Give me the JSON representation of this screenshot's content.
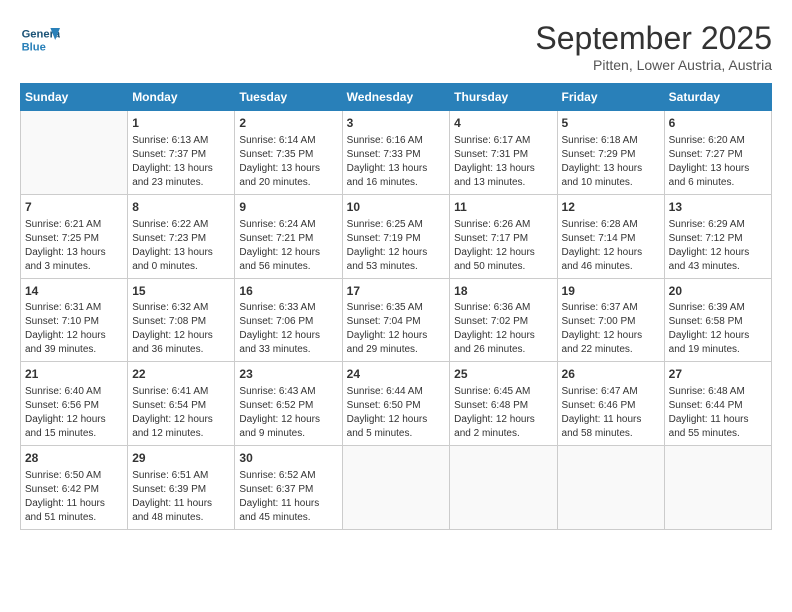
{
  "header": {
    "logo_general": "General",
    "logo_blue": "Blue",
    "title": "September 2025",
    "subtitle": "Pitten, Lower Austria, Austria"
  },
  "days_of_week": [
    "Sunday",
    "Monday",
    "Tuesday",
    "Wednesday",
    "Thursday",
    "Friday",
    "Saturday"
  ],
  "weeks": [
    [
      {
        "day": "",
        "content": ""
      },
      {
        "day": "1",
        "content": "Sunrise: 6:13 AM\nSunset: 7:37 PM\nDaylight: 13 hours\nand 23 minutes."
      },
      {
        "day": "2",
        "content": "Sunrise: 6:14 AM\nSunset: 7:35 PM\nDaylight: 13 hours\nand 20 minutes."
      },
      {
        "day": "3",
        "content": "Sunrise: 6:16 AM\nSunset: 7:33 PM\nDaylight: 13 hours\nand 16 minutes."
      },
      {
        "day": "4",
        "content": "Sunrise: 6:17 AM\nSunset: 7:31 PM\nDaylight: 13 hours\nand 13 minutes."
      },
      {
        "day": "5",
        "content": "Sunrise: 6:18 AM\nSunset: 7:29 PM\nDaylight: 13 hours\nand 10 minutes."
      },
      {
        "day": "6",
        "content": "Sunrise: 6:20 AM\nSunset: 7:27 PM\nDaylight: 13 hours\nand 6 minutes."
      }
    ],
    [
      {
        "day": "7",
        "content": "Sunrise: 6:21 AM\nSunset: 7:25 PM\nDaylight: 13 hours\nand 3 minutes."
      },
      {
        "day": "8",
        "content": "Sunrise: 6:22 AM\nSunset: 7:23 PM\nDaylight: 13 hours\nand 0 minutes."
      },
      {
        "day": "9",
        "content": "Sunrise: 6:24 AM\nSunset: 7:21 PM\nDaylight: 12 hours\nand 56 minutes."
      },
      {
        "day": "10",
        "content": "Sunrise: 6:25 AM\nSunset: 7:19 PM\nDaylight: 12 hours\nand 53 minutes."
      },
      {
        "day": "11",
        "content": "Sunrise: 6:26 AM\nSunset: 7:17 PM\nDaylight: 12 hours\nand 50 minutes."
      },
      {
        "day": "12",
        "content": "Sunrise: 6:28 AM\nSunset: 7:14 PM\nDaylight: 12 hours\nand 46 minutes."
      },
      {
        "day": "13",
        "content": "Sunrise: 6:29 AM\nSunset: 7:12 PM\nDaylight: 12 hours\nand 43 minutes."
      }
    ],
    [
      {
        "day": "14",
        "content": "Sunrise: 6:31 AM\nSunset: 7:10 PM\nDaylight: 12 hours\nand 39 minutes."
      },
      {
        "day": "15",
        "content": "Sunrise: 6:32 AM\nSunset: 7:08 PM\nDaylight: 12 hours\nand 36 minutes."
      },
      {
        "day": "16",
        "content": "Sunrise: 6:33 AM\nSunset: 7:06 PM\nDaylight: 12 hours\nand 33 minutes."
      },
      {
        "day": "17",
        "content": "Sunrise: 6:35 AM\nSunset: 7:04 PM\nDaylight: 12 hours\nand 29 minutes."
      },
      {
        "day": "18",
        "content": "Sunrise: 6:36 AM\nSunset: 7:02 PM\nDaylight: 12 hours\nand 26 minutes."
      },
      {
        "day": "19",
        "content": "Sunrise: 6:37 AM\nSunset: 7:00 PM\nDaylight: 12 hours\nand 22 minutes."
      },
      {
        "day": "20",
        "content": "Sunrise: 6:39 AM\nSunset: 6:58 PM\nDaylight: 12 hours\nand 19 minutes."
      }
    ],
    [
      {
        "day": "21",
        "content": "Sunrise: 6:40 AM\nSunset: 6:56 PM\nDaylight: 12 hours\nand 15 minutes."
      },
      {
        "day": "22",
        "content": "Sunrise: 6:41 AM\nSunset: 6:54 PM\nDaylight: 12 hours\nand 12 minutes."
      },
      {
        "day": "23",
        "content": "Sunrise: 6:43 AM\nSunset: 6:52 PM\nDaylight: 12 hours\nand 9 minutes."
      },
      {
        "day": "24",
        "content": "Sunrise: 6:44 AM\nSunset: 6:50 PM\nDaylight: 12 hours\nand 5 minutes."
      },
      {
        "day": "25",
        "content": "Sunrise: 6:45 AM\nSunset: 6:48 PM\nDaylight: 12 hours\nand 2 minutes."
      },
      {
        "day": "26",
        "content": "Sunrise: 6:47 AM\nSunset: 6:46 PM\nDaylight: 11 hours\nand 58 minutes."
      },
      {
        "day": "27",
        "content": "Sunrise: 6:48 AM\nSunset: 6:44 PM\nDaylight: 11 hours\nand 55 minutes."
      }
    ],
    [
      {
        "day": "28",
        "content": "Sunrise: 6:50 AM\nSunset: 6:42 PM\nDaylight: 11 hours\nand 51 minutes."
      },
      {
        "day": "29",
        "content": "Sunrise: 6:51 AM\nSunset: 6:39 PM\nDaylight: 11 hours\nand 48 minutes."
      },
      {
        "day": "30",
        "content": "Sunrise: 6:52 AM\nSunset: 6:37 PM\nDaylight: 11 hours\nand 45 minutes."
      },
      {
        "day": "",
        "content": ""
      },
      {
        "day": "",
        "content": ""
      },
      {
        "day": "",
        "content": ""
      },
      {
        "day": "",
        "content": ""
      }
    ]
  ]
}
